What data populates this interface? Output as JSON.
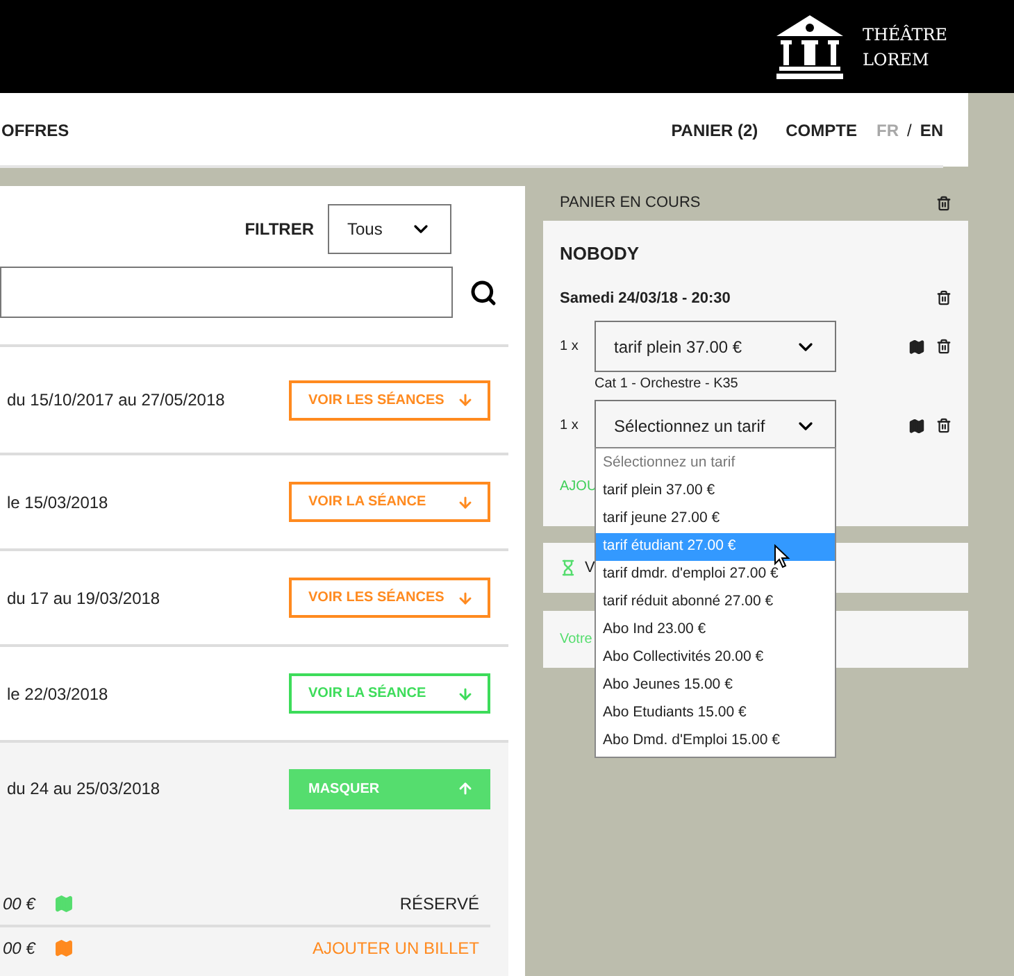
{
  "logo": {
    "line1": "THÉÂTRE",
    "line2": "LOREM"
  },
  "nav": {
    "left": "OFFRES",
    "cart": "PANIER (2)",
    "account": "COMPTE",
    "languages": [
      {
        "label": "FR",
        "selected": false
      },
      {
        "label": "EN",
        "selected": true
      }
    ],
    "separator": "/"
  },
  "filter": {
    "label": "FILTRER",
    "value": "Tous"
  },
  "shows": [
    {
      "dates": "du 15/10/2017 au 27/05/2018",
      "button": "VOIR LES SÉANCES",
      "kind": "outline",
      "color": "#ff8a1f",
      "expanded": false
    },
    {
      "dates": "le 15/03/2018",
      "button": "VOIR LA SÉANCE",
      "kind": "outline",
      "color": "#ff8a1f",
      "expanded": false
    },
    {
      "dates": "du 17 au 19/03/2018",
      "button": "VOIR LES SÉANCES",
      "kind": "outline",
      "color": "#ff8a1f",
      "expanded": false
    },
    {
      "dates": "le 22/03/2018",
      "button": "VOIR LA SÉANCE",
      "kind": "outline",
      "color": "#3ddc5a",
      "expanded": false
    },
    {
      "dates": "du 24 au 25/03/2018",
      "button": "MASQUER",
      "kind": "filled",
      "color": "#55dd6e",
      "expanded": true
    }
  ],
  "seats": [
    {
      "price": "00 €",
      "color": "#55dd6e",
      "action": "RÉSERVÉ",
      "kind": "status"
    },
    {
      "price": "00 €",
      "color": "#ff8a1f",
      "action": "AJOUTER UN BILLET",
      "kind": "link"
    }
  ],
  "cart": {
    "title": "PANIER EN COURS",
    "name": "NOBODY",
    "session": "Samedi 24/03/18 - 20:30",
    "tickets": [
      {
        "qty": "1 x",
        "tarif": "tarif plein 37.00 €",
        "seat": "Cat 1 - Orchestre - K35"
      },
      {
        "qty": "1 x",
        "tarif": "Sélectionnez un tarif"
      }
    ],
    "add_link": "AJOU",
    "timer_text": "V",
    "note": "Votre"
  },
  "dropdown": {
    "options": [
      {
        "label": "Sélectionnez un tarif",
        "selected": false,
        "kind": "placeholder"
      },
      {
        "label": "tarif plein 37.00 €",
        "selected": false
      },
      {
        "label": "tarif jeune 27.00 €",
        "selected": false
      },
      {
        "label": "tarif étudiant 27.00 €",
        "selected": true
      },
      {
        "label": "tarif dmdr. d'emploi 27.00 €",
        "selected": false
      },
      {
        "label": "tarif réduit abonné 27.00 €",
        "selected": false
      },
      {
        "label": "Abo Ind 23.00 €",
        "selected": false
      },
      {
        "label": "Abo Collectivités 20.00 €",
        "selected": false
      },
      {
        "label": "Abo Jeunes 15.00 €",
        "selected": false
      },
      {
        "label": "Abo Etudiants 15.00 €",
        "selected": false
      },
      {
        "label": "Abo Dmd. d'Emploi 15.00 €",
        "selected": false
      }
    ]
  }
}
